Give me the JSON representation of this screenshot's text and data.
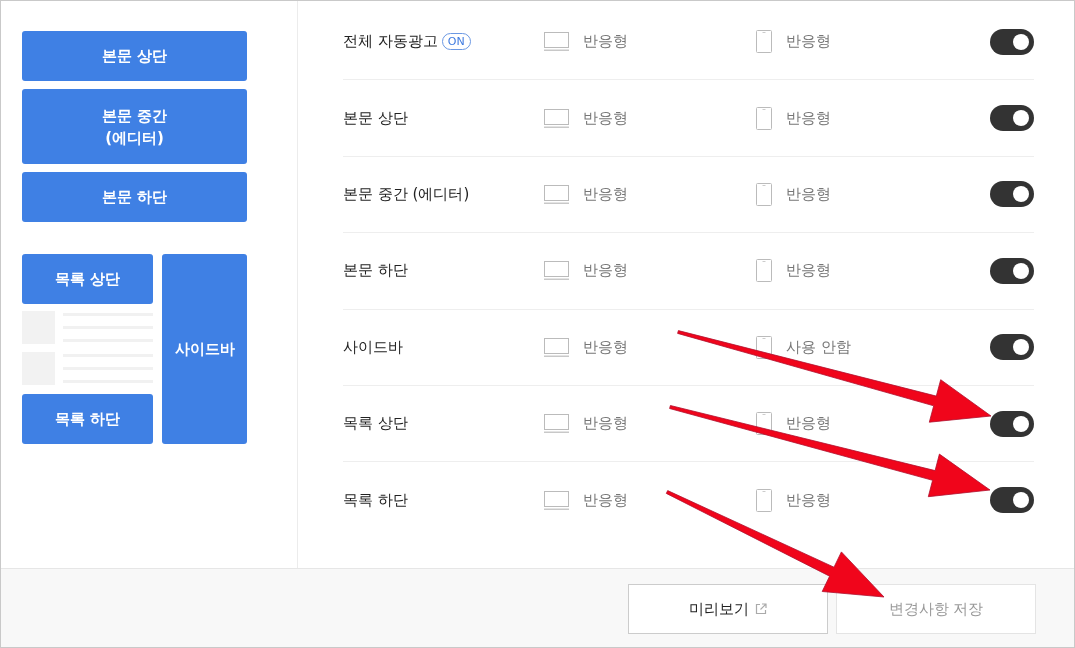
{
  "layout_preview": {
    "content_blocks": [
      "본문 상단",
      "본문 중간 (에디터)",
      "본문 하단"
    ],
    "list_top": "목록 상단",
    "list_bottom": "목록 하단",
    "sidebar": "사이드바"
  },
  "ad_rows": [
    {
      "label": "전체 자동광고",
      "badge": "ON",
      "desktop": "반응형",
      "mobile": "반응형",
      "on": true
    },
    {
      "label": "본문 상단",
      "desktop": "반응형",
      "mobile": "반응형",
      "on": true
    },
    {
      "label": "본문 중간 (에디터)",
      "desktop": "반응형",
      "mobile": "반응형",
      "on": true
    },
    {
      "label": "본문 하단",
      "desktop": "반응형",
      "mobile": "반응형",
      "on": true
    },
    {
      "label": "사이드바",
      "desktop": "반응형",
      "mobile": "사용 안함",
      "on": true
    },
    {
      "label": "목록 상단",
      "desktop": "반응형",
      "mobile": "반응형",
      "on": true
    },
    {
      "label": "목록 하단",
      "desktop": "반응형",
      "mobile": "반응형",
      "on": true
    }
  ],
  "buttons": [
    {
      "label": "미리보기",
      "kind": "external",
      "disabled": false
    },
    {
      "label": "변경사항 저장",
      "kind": "plain",
      "disabled": true
    }
  ]
}
